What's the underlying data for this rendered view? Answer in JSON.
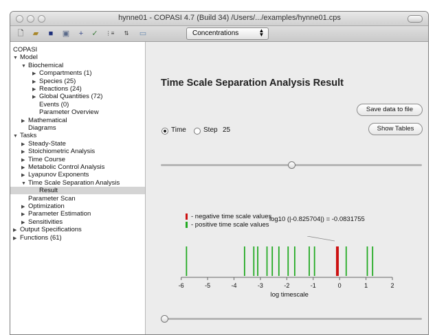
{
  "window": {
    "title": "hynne01 - COPASI 4.7 (Build 34) /Users/.../examples/hynne01.cps"
  },
  "toolbar": {
    "mode_select": "Concentrations"
  },
  "tree": [
    {
      "label": "COPASI",
      "level": 0,
      "toggle": "none"
    },
    {
      "label": "Model",
      "level": 0,
      "toggle": "expanded"
    },
    {
      "label": "Biochemical",
      "level": 1,
      "toggle": "expanded"
    },
    {
      "label": "Compartments (1)",
      "level": 2,
      "toggle": "collapsed"
    },
    {
      "label": "Species (25)",
      "level": 2,
      "toggle": "collapsed"
    },
    {
      "label": "Reactions (24)",
      "level": 2,
      "toggle": "collapsed"
    },
    {
      "label": "Global Quantities (72)",
      "level": 2,
      "toggle": "collapsed"
    },
    {
      "label": "Events (0)",
      "level": 2,
      "toggle": "none"
    },
    {
      "label": "Parameter Overview",
      "level": 2,
      "toggle": "none"
    },
    {
      "label": "Mathematical",
      "level": 1,
      "toggle": "collapsed"
    },
    {
      "label": "Diagrams",
      "level": 1,
      "toggle": "none"
    },
    {
      "label": "Tasks",
      "level": 0,
      "toggle": "expanded"
    },
    {
      "label": "Steady-State",
      "level": 1,
      "toggle": "collapsed"
    },
    {
      "label": "Stoichiometric Analysis",
      "level": 1,
      "toggle": "collapsed"
    },
    {
      "label": "Time Course",
      "level": 1,
      "toggle": "collapsed"
    },
    {
      "label": "Metabolic Control Analysis",
      "level": 1,
      "toggle": "collapsed"
    },
    {
      "label": "Lyapunov Exponents",
      "level": 1,
      "toggle": "collapsed"
    },
    {
      "label": "Time Scale Separation Analysis",
      "level": 1,
      "toggle": "expanded"
    },
    {
      "label": "Result",
      "level": 2,
      "toggle": "none",
      "selected": true
    },
    {
      "label": "Parameter Scan",
      "level": 1,
      "toggle": "none"
    },
    {
      "label": "Optimization",
      "level": 1,
      "toggle": "collapsed"
    },
    {
      "label": "Parameter Estimation",
      "level": 1,
      "toggle": "collapsed"
    },
    {
      "label": "Sensitivities",
      "level": 1,
      "toggle": "collapsed"
    },
    {
      "label": "Output Specifications",
      "level": 0,
      "toggle": "collapsed"
    },
    {
      "label": "Functions (61)",
      "level": 0,
      "toggle": "collapsed"
    }
  ],
  "main": {
    "title": "Time Scale Separation Analysis Result",
    "save_button": "Save data to file",
    "show_tables_button": "Show Tables",
    "radio_time": "Time",
    "radio_step": "Step",
    "step_value": "25",
    "selected_radio": "Time",
    "legend_negative": "- negative time scale values",
    "legend_positive": "- positive time scale values",
    "log_readout": "log10 (|-0.825704|) = -0.0831755",
    "top_slider_position": 0.5,
    "bottom_slider_position": 0.0
  },
  "chart_data": {
    "type": "scatter",
    "xlabel": "log timescale",
    "xlim": [
      -6.2,
      2
    ],
    "ticks": [
      "-6",
      "-5",
      "-4",
      "-3",
      "-2",
      "-1",
      "0",
      "1",
      "2"
    ],
    "positive_values": [
      -5.8,
      -3.6,
      -3.25,
      -3.1,
      -2.75,
      -2.55,
      -2.3,
      -1.95,
      -1.7,
      -1.15,
      -0.95,
      0.25,
      1.05,
      1.25
    ],
    "negative_values": [
      -0.0831755
    ],
    "colors": {
      "positive": "#22aa22",
      "negative": "#cc1111"
    }
  }
}
